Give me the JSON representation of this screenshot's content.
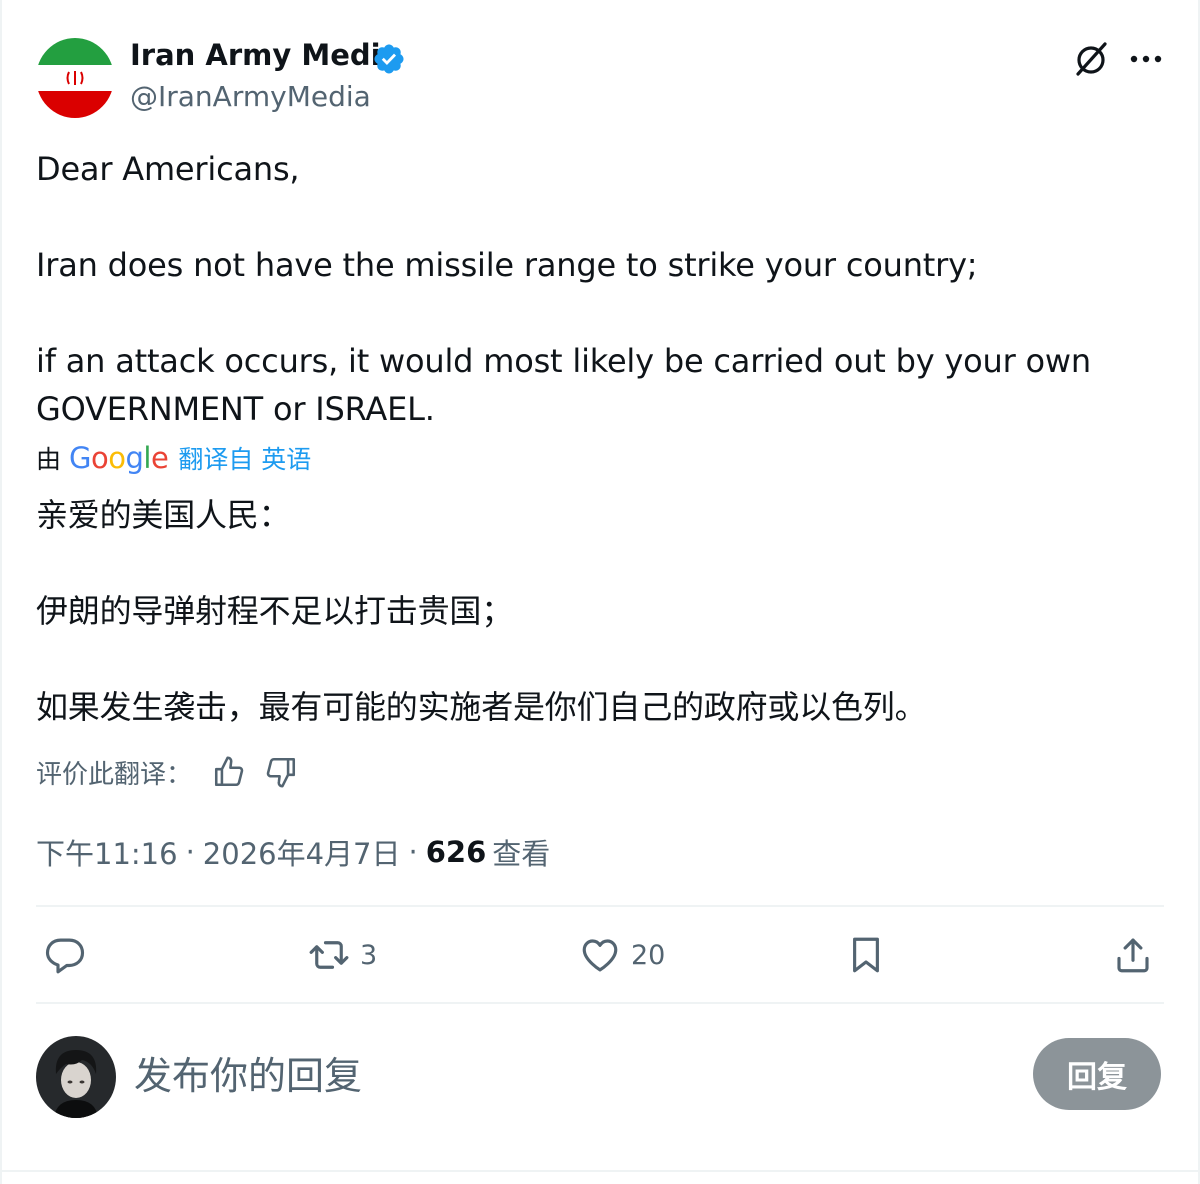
{
  "author": {
    "name": "Iran Army Media",
    "handle": "@IranArmyMedia",
    "avatar_icon": "iran-flag",
    "verified_icon": "verified-badge-icon"
  },
  "tweet": {
    "original_lines": [
      "Dear Americans,",
      "Iran does not have the missile range to strike your country;",
      "if an attack occurs, it would most likely be carried out by your own",
      "GOVERNMENT or ISRAEL."
    ],
    "translated_by": "由",
    "google_letters": [
      "G",
      "o",
      "o",
      "g",
      "l",
      "e"
    ],
    "translated_from": "翻译自 英语",
    "translated_lines": [
      "亲爱的美国人民：",
      "伊朗的导弹射程不足以打击贵国；",
      "如果发生袭击，最有可能的实施者是你们自己的政府或以色列。"
    ],
    "rate_label": "评价此翻译："
  },
  "meta": {
    "time": "下午11:16",
    "date": "2026年4月7日",
    "separator": "·",
    "views_count": "626",
    "views_label": "查看"
  },
  "actions": {
    "reply_count": "",
    "retweet_count": "3",
    "like_count": "20"
  },
  "composer": {
    "placeholder": "发布你的回复",
    "button_label": "回复"
  },
  "colors": {
    "text": "#0f1419",
    "secondary": "#536471",
    "accent": "#1d9bf0",
    "divider": "#eff3f4",
    "reply_button_bg": "#8c9499"
  }
}
